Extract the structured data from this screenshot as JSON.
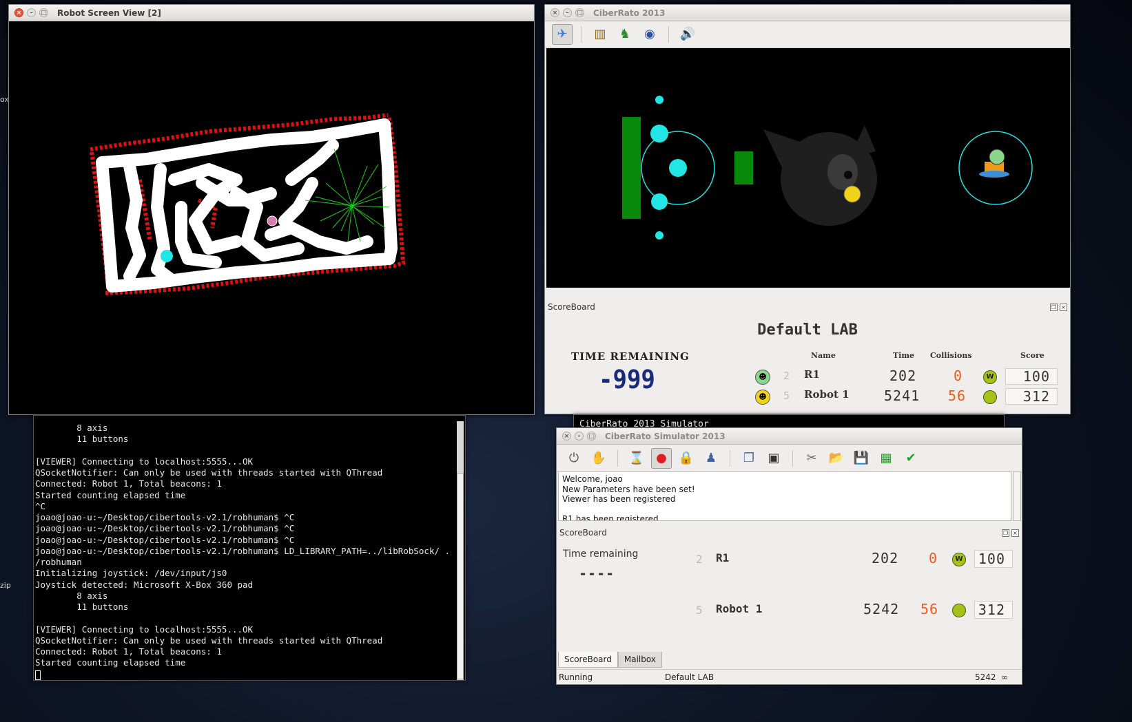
{
  "robot_view": {
    "title": "Robot Screen View [2]"
  },
  "ciberrato": {
    "title": "CiberRato 2013",
    "scoreboard": {
      "dock_title": "ScoreBoard",
      "lab_name": "Default LAB",
      "time_remaining_label": "TIME REMAINING",
      "time_remaining_value": "-999",
      "columns": [
        "Name",
        "Time",
        "Collisions",
        "Score"
      ],
      "rows": [
        {
          "pos": "2",
          "name": "R1",
          "time": "202",
          "collisions": "0",
          "score": "100",
          "ball": "W"
        },
        {
          "pos": "5",
          "name": "Robot 1",
          "time": "5241",
          "collisions": "56",
          "score": "312",
          "ball": ""
        }
      ]
    }
  },
  "terminal": {
    "lines": [
      "        8 axis",
      "        11 buttons",
      "",
      "[VIEWER] Connecting to localhost:5555...OK",
      "QSocketNotifier: Can only be used with threads started with QThread",
      "Connected: Robot 1, Total beacons: 1",
      "Started counting elapsed time",
      "^C",
      "joao@joao-u:~/Desktop/cibertools-v2.1/robhuman$ ^C",
      "joao@joao-u:~/Desktop/cibertools-v2.1/robhuman$ ^C",
      "joao@joao-u:~/Desktop/cibertools-v2.1/robhuman$ ^C",
      "joao@joao-u:~/Desktop/cibertools-v2.1/robhuman$ LD_LIBRARY_PATH=../libRobSock/ .",
      "/robhuman",
      "Initializing joystick: /dev/input/js0",
      "Joystick detected: Microsoft X-Box 360 pad",
      "        8 axis",
      "        11 buttons",
      "",
      "[VIEWER] Connecting to localhost:5555...OK",
      "QSocketNotifier: Can only be used with threads started with QThread",
      "Connected: Robot 1, Total beacons: 1",
      "Started counting elapsed time"
    ]
  },
  "simulator_behind": {
    "title": "CiberRato 2013 Simulator"
  },
  "simulator": {
    "title": "CiberRato Simulator 2013",
    "messages": [
      "Welcome, joao",
      "New Parameters have been set!",
      "Viewer has been registered",
      "",
      "R1 has been registered"
    ],
    "scoreboard": {
      "dock_title": "ScoreBoard",
      "time_remaining_label": "Time remaining",
      "time_remaining_value": "----",
      "rows": [
        {
          "pos": "2",
          "name": "R1",
          "time": "202",
          "collisions": "0",
          "score": "100",
          "ball": "W"
        },
        {
          "pos": "5",
          "name": "Robot 1",
          "time": "5242",
          "collisions": "56",
          "score": "312",
          "ball": ""
        }
      ]
    },
    "tabs": [
      "ScoreBoard",
      "Mailbox"
    ],
    "status": {
      "state": "Running",
      "lab": "Default LAB",
      "time": "5242",
      "infinity": "∞"
    }
  },
  "colors": {
    "accent_cyan": "#22e5e5",
    "wall_green": "#0a8a0a",
    "lcd_orange": "#f05a1a",
    "lcd_blue": "#1a2a7a"
  },
  "icons": {
    "desktop_left": [
      "ox",
      "zip"
    ]
  }
}
